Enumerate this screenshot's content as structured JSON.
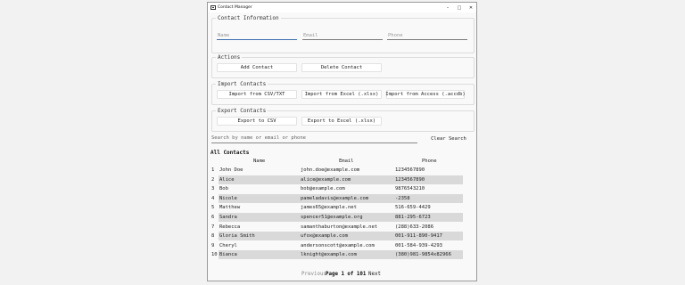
{
  "window": {
    "title": "Contact Manager"
  },
  "controls": {
    "minimize": "–",
    "maximize": "□",
    "close": "✕"
  },
  "contact_info": {
    "legend": "Contact Information",
    "name_placeholder": "Name",
    "email_placeholder": "Email",
    "phone_placeholder": "Phone"
  },
  "actions": {
    "legend": "Actions",
    "add": "Add Contact",
    "delete": "Delete Contact"
  },
  "import": {
    "legend": "Import Contacts",
    "csv": "Import from CSV/TXT",
    "excel": "Import from Excel (.xlsx)",
    "access": "Import from Access (.accdb)"
  },
  "export": {
    "legend": "Export Contacts",
    "csv": "Export to CSV",
    "excel": "Export to Excel (.xlsx)"
  },
  "search": {
    "placeholder": "Search by name or email or phone",
    "clear": "Clear Search"
  },
  "list": {
    "title": "All Contacts",
    "columns": [
      "Name",
      "Email",
      "Phone"
    ],
    "rows": [
      {
        "num": "1",
        "name": "John Doe",
        "email": "john.doe@example.com",
        "phone": "1234567890"
      },
      {
        "num": "2",
        "name": "Alice",
        "email": "alice@example.com",
        "phone": "1234567890"
      },
      {
        "num": "3",
        "name": "Bob",
        "email": "bob@example.com",
        "phone": "9876543210"
      },
      {
        "num": "4",
        "name": "Nicole",
        "email": "pameladavis@example.com",
        "phone": "-2358"
      },
      {
        "num": "5",
        "name": "Matthew",
        "email": "james65@example.net",
        "phone": "516-659-4429"
      },
      {
        "num": "6",
        "name": "Sandra",
        "email": "spencer51@example.org",
        "phone": "881-295-6723"
      },
      {
        "num": "7",
        "name": "Rebecca",
        "email": "samanthaburton@example.net",
        "phone": "(288)633-2086"
      },
      {
        "num": "8",
        "name": "Gloria Smith",
        "email": "ufox@example.com",
        "phone": "001-911-890-9417"
      },
      {
        "num": "9",
        "name": "Cheryl",
        "email": "andersonscott@example.com",
        "phone": "001-584-939-4293"
      },
      {
        "num": "10",
        "name": "Bianca",
        "email": "lknight@example.com",
        "phone": "(380)981-9854x82966"
      }
    ]
  },
  "pagination": {
    "previous": "Previous",
    "page_label": "Page 1 of 101",
    "next": "Next"
  }
}
